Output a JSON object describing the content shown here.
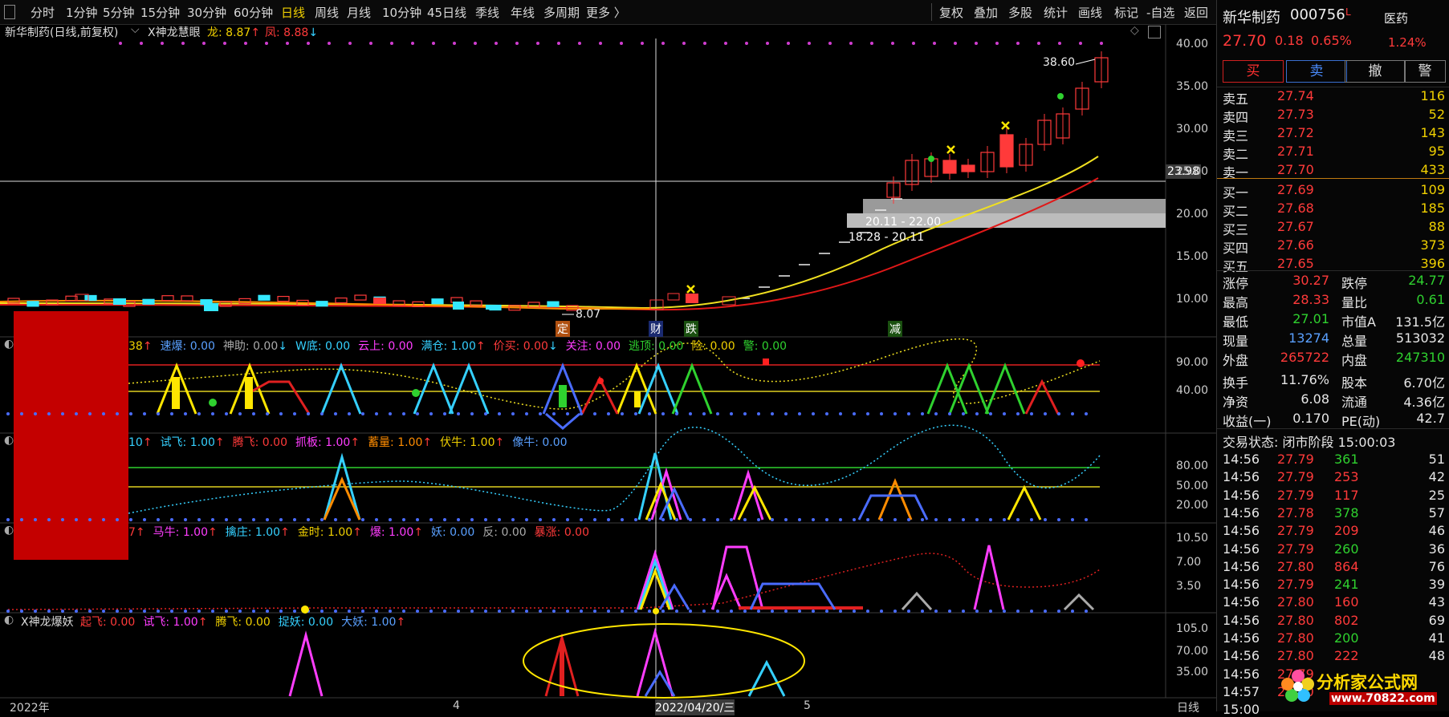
{
  "toolbar": {
    "left": [
      "分时",
      "1分钟",
      "5分钟",
      "15分钟",
      "30分钟",
      "60分钟",
      "日线",
      "周线",
      "月线",
      "10分钟",
      "45日线",
      "季线",
      "年线",
      "多周期",
      "更多 〉"
    ],
    "active": "日线",
    "right": [
      "复权",
      "叠加",
      "多股",
      "统计",
      "画线",
      "标记",
      "-自选",
      "返回"
    ]
  },
  "main": {
    "title": "新华制药(日线,前复权)",
    "indicator_name": "X神龙慧眼",
    "long_label": "龙: 8.87",
    "feng_label": "凤: 8.88",
    "price_axis": [
      "40.00",
      "35.00",
      "30.00",
      "25.00",
      "20.00",
      "15.00",
      "10.00"
    ],
    "crosshair_value": "23.98",
    "high_label": "38.60",
    "low_label": "8.07",
    "zone_labels": [
      "20.11 - 22.00",
      "18.28 - 20.11"
    ],
    "markers": [
      "定",
      "财",
      "跌",
      "减"
    ]
  },
  "panel1": {
    "items": [
      {
        "t": "38",
        "c": "yellow",
        "arrow": "↑"
      },
      {
        "t": "速爆: 0.00",
        "c": "blue"
      },
      {
        "t": "神助: 0.00",
        "c": "gray",
        "arrow": "↓"
      },
      {
        "t": "W底: 0.00",
        "c": "cyan"
      },
      {
        "t": "云上: 0.00",
        "c": "magenta"
      },
      {
        "t": "满仓: 1.00",
        "c": "cyan",
        "arrow": "↑"
      },
      {
        "t": "价买: 0.00",
        "c": "red",
        "arrow": "↓"
      },
      {
        "t": "关注: 0.00",
        "c": "magenta"
      },
      {
        "t": "逃顶: 0.00",
        "c": "green"
      },
      {
        "t": "险: 0.00",
        "c": "yellow"
      },
      {
        "t": "警: 0.00",
        "c": "green"
      }
    ],
    "axis": [
      "90.00",
      "40.00"
    ]
  },
  "panel2": {
    "items": [
      {
        "t": "10",
        "c": "cyan",
        "arrow": "↑"
      },
      {
        "t": "试飞: 1.00",
        "c": "cyan",
        "arrow": "↑"
      },
      {
        "t": "腾飞: 0.00",
        "c": "red"
      },
      {
        "t": "抓板: 1.00",
        "c": "magenta",
        "arrow": "↑"
      },
      {
        "t": "蓄量: 1.00",
        "c": "orange",
        "arrow": "↑"
      },
      {
        "t": "伏牛: 1.00",
        "c": "yellow",
        "arrow": "↑"
      },
      {
        "t": "像牛: 0.00",
        "c": "blue"
      }
    ],
    "axis": [
      "80.00",
      "50.00",
      "20.00"
    ]
  },
  "panel3": {
    "items": [
      {
        "t": "7",
        "c": "red",
        "arrow": "↑"
      },
      {
        "t": "马牛: 1.00",
        "c": "magenta",
        "arrow": "↑"
      },
      {
        "t": "擒庄: 1.00",
        "c": "cyan",
        "arrow": "↑"
      },
      {
        "t": "金时: 1.00",
        "c": "yellow",
        "arrow": "↑"
      },
      {
        "t": "爆: 1.00",
        "c": "magenta",
        "arrow": "↑"
      },
      {
        "t": "妖: 0.00",
        "c": "blue"
      },
      {
        "t": "反: 0.00",
        "c": "gray"
      },
      {
        "t": "暴涨: 0.00",
        "c": "red"
      }
    ],
    "axis": [
      "10.50",
      "7.00",
      "3.50"
    ]
  },
  "panel4": {
    "name": "X神龙爆妖",
    "items": [
      {
        "t": "起飞: 0.00",
        "c": "red"
      },
      {
        "t": "试飞: 1.00",
        "c": "magenta",
        "arrow": "↑"
      },
      {
        "t": "腾飞: 0.00",
        "c": "yellow"
      },
      {
        "t": "捉妖: 0.00",
        "c": "cyan"
      },
      {
        "t": "大妖: 1.00",
        "c": "blue",
        "arrow": "↑"
      }
    ],
    "axis": [
      "105.0",
      "70.00",
      "35.00"
    ]
  },
  "xaxis": [
    "2022年",
    "4",
    "2022/04/20/三",
    "5",
    "日线"
  ],
  "quote": {
    "name": "新华制药",
    "code": "000756",
    "sector": "医药",
    "price": "27.70",
    "change": "0.18",
    "pct": "0.65%",
    "sector_pct": "1.24%",
    "buttons": [
      "买",
      "卖",
      "撤",
      "警"
    ],
    "sell": [
      {
        "l": "卖五",
        "p": "27.74",
        "v": "116"
      },
      {
        "l": "卖四",
        "p": "27.73",
        "v": "52"
      },
      {
        "l": "卖三",
        "p": "27.72",
        "v": "143"
      },
      {
        "l": "卖二",
        "p": "27.71",
        "v": "95"
      },
      {
        "l": "卖一",
        "p": "27.70",
        "v": "433"
      }
    ],
    "buy": [
      {
        "l": "买一",
        "p": "27.69",
        "v": "109"
      },
      {
        "l": "买二",
        "p": "27.68",
        "v": "185"
      },
      {
        "l": "买三",
        "p": "27.67",
        "v": "88"
      },
      {
        "l": "买四",
        "p": "27.66",
        "v": "373"
      },
      {
        "l": "买五",
        "p": "27.65",
        "v": "396"
      }
    ],
    "stats": [
      [
        {
          "l": "涨停",
          "v": "30.27",
          "c": "red"
        },
        {
          "l": "跌停",
          "v": "24.77",
          "c": "green"
        }
      ],
      [
        {
          "l": "最高",
          "v": "28.33",
          "c": "red"
        },
        {
          "l": "量比",
          "v": "0.61",
          "c": "green"
        }
      ],
      [
        {
          "l": "最低",
          "v": "27.01",
          "c": "green"
        },
        {
          "l": "市值A",
          "v": "131.5亿",
          "c": "white"
        }
      ],
      [
        {
          "l": "现量",
          "v": "13274",
          "c": "blue"
        },
        {
          "l": "总量",
          "v": "513032",
          "c": "white"
        }
      ],
      [
        {
          "l": "外盘",
          "v": "265722",
          "c": "red"
        },
        {
          "l": "内盘",
          "v": "247310",
          "c": "green"
        }
      ],
      [
        {
          "l": "换手",
          "v": "11.76%",
          "c": "white"
        },
        {
          "l": "股本",
          "v": "6.70亿",
          "c": "white"
        }
      ],
      [
        {
          "l": "净资",
          "v": "6.08",
          "c": "white"
        },
        {
          "l": "流通",
          "v": "4.36亿",
          "c": "white"
        }
      ],
      [
        {
          "l": "收益(一)",
          "v": "0.170",
          "c": "white"
        },
        {
          "l": "PE(动)",
          "v": "42.7",
          "c": "white"
        }
      ]
    ],
    "trade_status": "交易状态: 闭市阶段 15:00:03",
    "ticks": [
      {
        "t": "14:56",
        "p": "27.79",
        "v": "361",
        "c": "green",
        "n": "51"
      },
      {
        "t": "14:56",
        "p": "27.79",
        "v": "253",
        "c": "red",
        "n": "42"
      },
      {
        "t": "14:56",
        "p": "27.79",
        "v": "117",
        "c": "red",
        "n": "25"
      },
      {
        "t": "14:56",
        "p": "27.78",
        "v": "378",
        "c": "green",
        "n": "57"
      },
      {
        "t": "14:56",
        "p": "27.79",
        "v": "209",
        "c": "red",
        "n": "46"
      },
      {
        "t": "14:56",
        "p": "27.79",
        "v": "260",
        "c": "green",
        "n": "36"
      },
      {
        "t": "14:56",
        "p": "27.80",
        "v": "864",
        "c": "red",
        "n": "76"
      },
      {
        "t": "14:56",
        "p": "27.79",
        "v": "241",
        "c": "green",
        "n": "39"
      },
      {
        "t": "14:56",
        "p": "27.80",
        "v": "160",
        "c": "red",
        "n": "43"
      },
      {
        "t": "14:56",
        "p": "27.80",
        "v": "802",
        "c": "red",
        "n": "69"
      },
      {
        "t": "14:56",
        "p": "27.80",
        "v": "200",
        "c": "green",
        "n": "41"
      },
      {
        "t": "14:56",
        "p": "27.80",
        "v": "222",
        "c": "red",
        "n": "48"
      },
      {
        "t": "14:56",
        "p": "27.79",
        "v": "",
        "c": "green",
        "n": ""
      },
      {
        "t": "14:57",
        "p": "27.80",
        "v": "",
        "c": "red",
        "n": ""
      },
      {
        "t": "15:00",
        "p": "",
        "v": "",
        "c": "red",
        "n": ""
      }
    ]
  },
  "watermark": {
    "brand": "分析家公式网",
    "url": "www.70822.com"
  },
  "colors": {
    "up": "#ff3a3a",
    "down": "#35e8ff",
    "ma_yellow": "#f0e020",
    "ma_red": "#e01818",
    "panel_bg": "#000000"
  }
}
